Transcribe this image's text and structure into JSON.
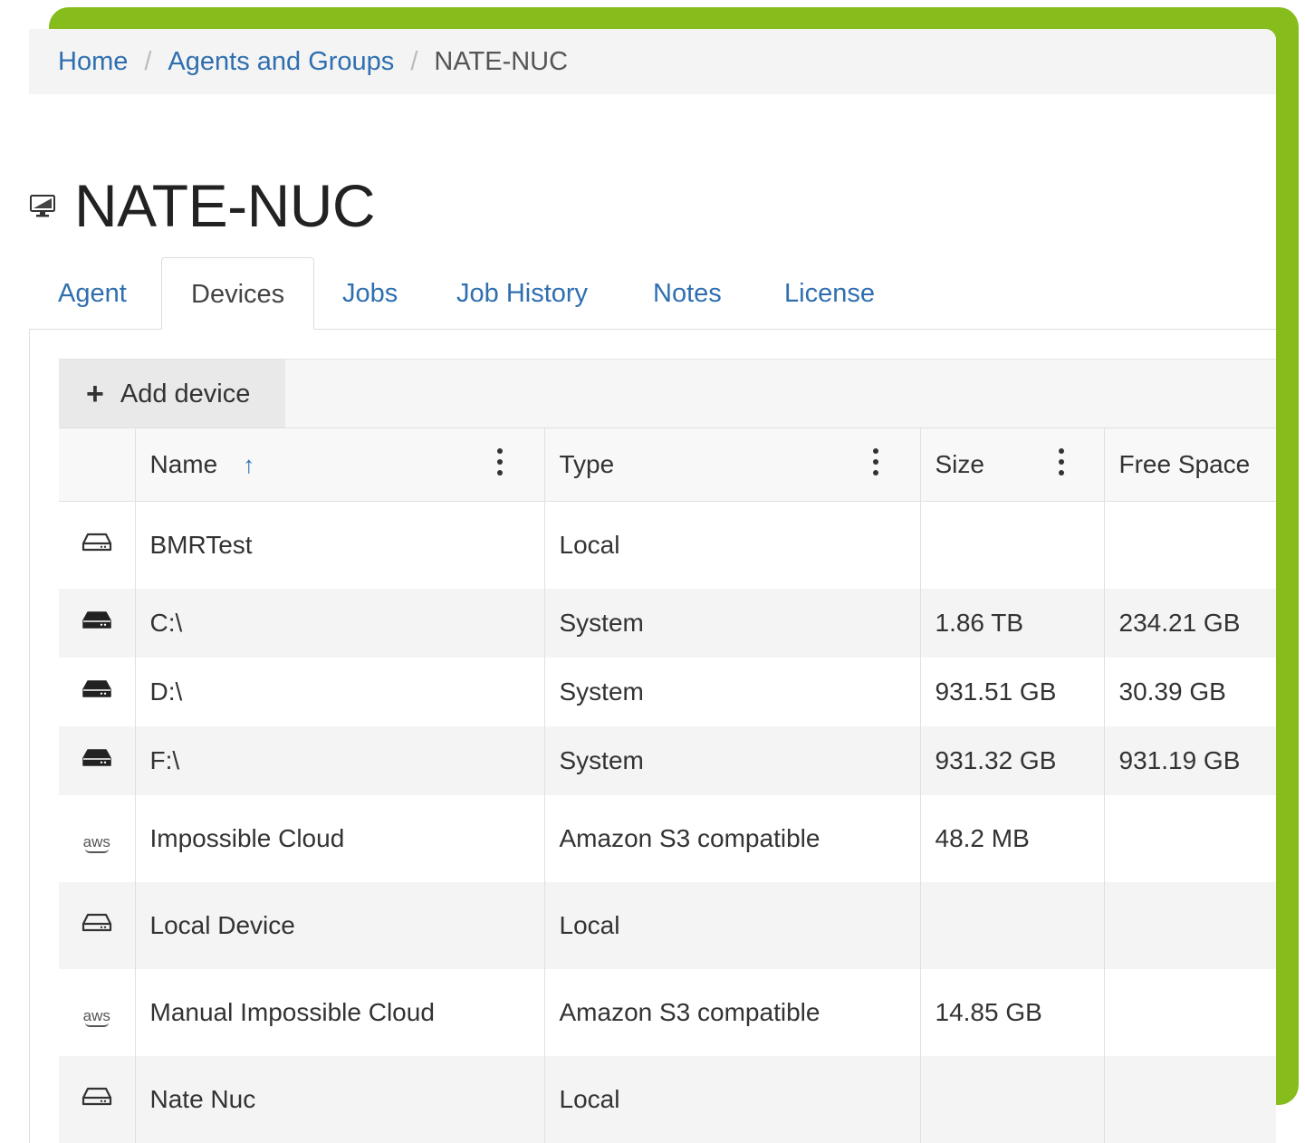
{
  "breadcrumb": {
    "items": [
      {
        "label": "Home"
      },
      {
        "label": "Agents and Groups"
      },
      {
        "label": "NATE-NUC"
      }
    ],
    "separator": "/"
  },
  "page": {
    "title": "NATE-NUC",
    "icon": "computer-icon"
  },
  "tabs": [
    {
      "label": "Agent",
      "active": false
    },
    {
      "label": "Devices",
      "active": true
    },
    {
      "label": "Jobs",
      "active": false
    },
    {
      "label": "Job History",
      "active": false
    },
    {
      "label": "Notes",
      "active": false
    },
    {
      "label": "License",
      "active": false
    }
  ],
  "toolbar": {
    "add_device_label": "Add device",
    "add_icon": "plus-icon"
  },
  "table": {
    "columns": [
      {
        "label": "",
        "key": "icon"
      },
      {
        "label": "Name",
        "sorted": "ascending"
      },
      {
        "label": "Type"
      },
      {
        "label": "Size"
      },
      {
        "label": "Free Space"
      }
    ],
    "rows": [
      {
        "icon": "hdd-outline-icon",
        "name": "BMRTest",
        "type": "Local",
        "size": "",
        "free": ""
      },
      {
        "icon": "hdd-solid-icon",
        "name": "C:\\",
        "type": "System",
        "size": "1.86 TB",
        "free": "234.21 GB"
      },
      {
        "icon": "hdd-solid-icon",
        "name": "D:\\",
        "type": "System",
        "size": "931.51 GB",
        "free": "30.39 GB"
      },
      {
        "icon": "hdd-solid-icon",
        "name": "F:\\",
        "type": "System",
        "size": "931.32 GB",
        "free": "931.19 GB"
      },
      {
        "icon": "aws-icon",
        "name": "Impossible Cloud",
        "type": "Amazon S3 compatible",
        "size": "48.2 MB",
        "free": ""
      },
      {
        "icon": "hdd-outline-icon",
        "name": "Local Device",
        "type": "Local",
        "size": "",
        "free": ""
      },
      {
        "icon": "aws-icon",
        "name": "Manual Impossible Cloud",
        "type": "Amazon S3 compatible",
        "size": "14.85 GB",
        "free": ""
      },
      {
        "icon": "hdd-outline-icon",
        "name": "Nate Nuc",
        "type": "Local",
        "size": "",
        "free": ""
      }
    ],
    "aws_icon_text": "aws"
  },
  "colors": {
    "accent_frame": "#86bc1c",
    "link": "#2f6fb0",
    "row_alt": "#f4f4f4"
  }
}
